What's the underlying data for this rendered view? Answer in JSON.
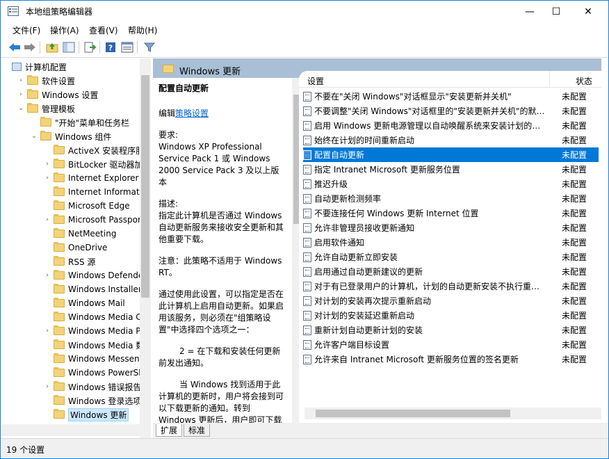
{
  "window": {
    "title": "本地组策略编辑器",
    "minimize": "—",
    "maximize": "☐",
    "close": "✕"
  },
  "menu": [
    "文件(F)",
    "操作(A)",
    "查看(V)",
    "帮助(H)"
  ],
  "toolbar": {
    "icons": [
      "back-icon",
      "forward-icon",
      "up-folder-icon",
      "show-hide-tree-icon",
      "export-list-icon",
      "help-icon",
      "properties-icon",
      "filter-icon"
    ]
  },
  "tree": {
    "items": [
      {
        "label": "计算机配置",
        "arrow": "",
        "icon": "computer",
        "indent": 0
      },
      {
        "label": "软件设置",
        "arrow": "›",
        "icon": "folder",
        "indent": 1
      },
      {
        "label": "Windows 设置",
        "arrow": "›",
        "icon": "folder",
        "indent": 1
      },
      {
        "label": "管理模板",
        "arrow": "⌄",
        "icon": "folder",
        "indent": 1
      },
      {
        "label": "\"开始\"菜单和任务栏",
        "arrow": "",
        "icon": "folder",
        "indent": 2
      },
      {
        "label": "Windows 组件",
        "arrow": "⌄",
        "icon": "folder",
        "indent": 2
      },
      {
        "label": "ActiveX 安装程序服务",
        "arrow": "",
        "icon": "folder",
        "indent": 3
      },
      {
        "label": "BitLocker 驱动器加密",
        "arrow": "›",
        "icon": "folder",
        "indent": 3
      },
      {
        "label": "Internet Explorer",
        "arrow": "›",
        "icon": "folder",
        "indent": 3
      },
      {
        "label": "Internet Information",
        "arrow": "",
        "icon": "folder",
        "indent": 3
      },
      {
        "label": "Microsoft Edge",
        "arrow": "",
        "icon": "folder",
        "indent": 3
      },
      {
        "label": "Microsoft Passport f",
        "arrow": "›",
        "icon": "folder",
        "indent": 3
      },
      {
        "label": "NetMeeting",
        "arrow": "",
        "icon": "folder",
        "indent": 3
      },
      {
        "label": "OneDrive",
        "arrow": "",
        "icon": "folder",
        "indent": 3
      },
      {
        "label": "RSS 源",
        "arrow": "",
        "icon": "folder",
        "indent": 3
      },
      {
        "label": "Windows Defender",
        "arrow": "›",
        "icon": "folder",
        "indent": 3
      },
      {
        "label": "Windows Installer",
        "arrow": "",
        "icon": "folder",
        "indent": 3
      },
      {
        "label": "Windows Mail",
        "arrow": "",
        "icon": "folder",
        "indent": 3
      },
      {
        "label": "Windows Media Cen",
        "arrow": "",
        "icon": "folder",
        "indent": 3
      },
      {
        "label": "Windows Media Play",
        "arrow": "›",
        "icon": "folder",
        "indent": 3
      },
      {
        "label": "Windows Media 数字",
        "arrow": "",
        "icon": "folder",
        "indent": 3
      },
      {
        "label": "Windows Messenge",
        "arrow": "",
        "icon": "folder",
        "indent": 3
      },
      {
        "label": "Windows PowerShel",
        "arrow": "",
        "icon": "folder",
        "indent": 3
      },
      {
        "label": "Windows 错误报告",
        "arrow": "›",
        "icon": "folder",
        "indent": 3
      },
      {
        "label": "Windows 登录选项",
        "arrow": "",
        "icon": "folder",
        "indent": 3
      },
      {
        "label": "Windows 更新",
        "arrow": "",
        "icon": "folder",
        "indent": 3,
        "selected": true
      }
    ]
  },
  "header": {
    "title": "Windows 更新"
  },
  "description": {
    "policy_title": "配置自动更新",
    "edit_prefix": "编辑",
    "edit_link": "策略设置",
    "requirements_label": "要求:",
    "requirements_text": "Windows XP Professional Service Pack 1 或 Windows 2000 Service Pack 3 及以上版本",
    "desc_label": "描述:",
    "desc_text": "指定此计算机是否通过 Windows 自动更新服务来接收安全更新和其他重要下载。",
    "note": "注意：此策略不适用于 Windows RT。",
    "para1": "通过使用此设置，可以指定是否在此计算机上启用自动更新。如果启用该服务，则必须在\"组策略设置\"中选择四个选项之一：",
    "para2": "2 = 在下载和安装任何更新前发出通知。",
    "para3": "当 Windows 找到适用于此计算机的更新时，用户将会接到可以下载更新的通知。转到 Windows 更新后，用户即可下载"
  },
  "list": {
    "col_setting": "设置",
    "col_state": "状态",
    "rows": [
      {
        "name": "不要在\"关闭 Windows\"对话框显示\"安装更新并关机\"",
        "state": "未配置"
      },
      {
        "name": "不要调整\"关闭 Windows\"对话框里的\"安装更新并关机\"的默…",
        "state": "未配置"
      },
      {
        "name": "启用 Windows 更新电源管理以自动唤醒系统来安装计划的…",
        "state": "未配置"
      },
      {
        "name": "始终在计划的时间重新启动",
        "state": "未配置"
      },
      {
        "name": "配置自动更新",
        "state": "未配置",
        "selected": true
      },
      {
        "name": "指定 Intranet Microsoft 更新服务位置",
        "state": "未配置"
      },
      {
        "name": "推迟升级",
        "state": "未配置"
      },
      {
        "name": "自动更新检测频率",
        "state": "未配置"
      },
      {
        "name": "不要连接任何 Windows 更新 Internet 位置",
        "state": "未配置"
      },
      {
        "name": "允许非管理员接收更新通知",
        "state": "未配置"
      },
      {
        "name": "启用软件通知",
        "state": "未配置"
      },
      {
        "name": "允许自动更新立即安装",
        "state": "未配置"
      },
      {
        "name": "启用通过自动更新建议的更新",
        "state": "未配置"
      },
      {
        "name": "对于有已登录用户的计算机，计划的自动更新安装不执行重…",
        "state": "未配置"
      },
      {
        "name": "对计划的安装再次提示重新启动",
        "state": "未配置"
      },
      {
        "name": "对计划的安装延迟重新启动",
        "state": "未配置"
      },
      {
        "name": "重新计划自动更新计划的安装",
        "state": "未配置"
      },
      {
        "name": "允许客户端目标设置",
        "state": "未配置"
      },
      {
        "name": "允许来自 Intranet Microsoft 更新服务位置的签名更新",
        "state": "未配置"
      }
    ]
  },
  "tabs": [
    "扩展",
    "标准"
  ],
  "status": {
    "text": "19 个设置"
  },
  "colors": {
    "accent": "#0078d7",
    "header_band": "#a9bfd6",
    "border": "#1883d7"
  }
}
